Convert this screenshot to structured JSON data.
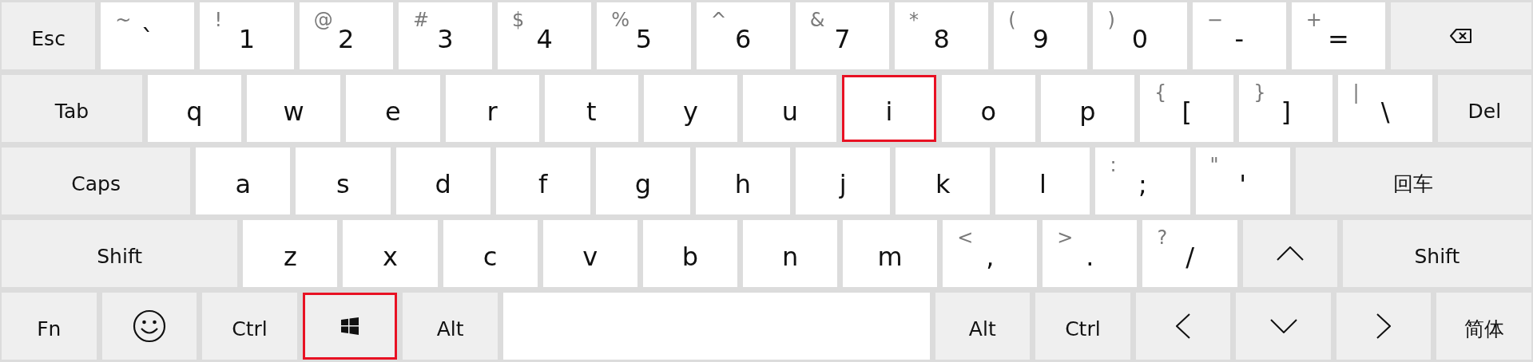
{
  "rows": [
    [
      {
        "kind": "func",
        "label": "Esc",
        "highlighted": false
      },
      {
        "kind": "char",
        "shift": "~",
        "label": "`",
        "highlighted": false
      },
      {
        "kind": "char",
        "shift": "!",
        "label": "1",
        "highlighted": false
      },
      {
        "kind": "char",
        "shift": "@",
        "label": "2",
        "highlighted": false
      },
      {
        "kind": "char",
        "shift": "#",
        "label": "3",
        "highlighted": false
      },
      {
        "kind": "char",
        "shift": "$",
        "label": "4",
        "highlighted": false
      },
      {
        "kind": "char",
        "shift": "%",
        "label": "5",
        "highlighted": false
      },
      {
        "kind": "char",
        "shift": "^",
        "label": "6",
        "highlighted": false
      },
      {
        "kind": "char",
        "shift": "&",
        "label": "7",
        "highlighted": false
      },
      {
        "kind": "char",
        "shift": "*",
        "label": "8",
        "highlighted": false
      },
      {
        "kind": "char",
        "shift": "(",
        "label": "9",
        "highlighted": false
      },
      {
        "kind": "char",
        "shift": ")",
        "label": "0",
        "highlighted": false
      },
      {
        "kind": "char",
        "shift": "−",
        "label": "-",
        "highlighted": false
      },
      {
        "kind": "char",
        "shift": "+",
        "label": "=",
        "highlighted": false
      },
      {
        "kind": "backspace",
        "highlighted": false
      }
    ],
    [
      {
        "kind": "func",
        "label": "Tab",
        "highlighted": false
      },
      {
        "kind": "char",
        "label": "q",
        "highlighted": false
      },
      {
        "kind": "char",
        "label": "w",
        "highlighted": false
      },
      {
        "kind": "char",
        "label": "e",
        "highlighted": false
      },
      {
        "kind": "char",
        "label": "r",
        "highlighted": false
      },
      {
        "kind": "char",
        "label": "t",
        "highlighted": false
      },
      {
        "kind": "char",
        "label": "y",
        "highlighted": false
      },
      {
        "kind": "char",
        "label": "u",
        "highlighted": false
      },
      {
        "kind": "char",
        "label": "i",
        "highlighted": true
      },
      {
        "kind": "char",
        "label": "o",
        "highlighted": false
      },
      {
        "kind": "char",
        "label": "p",
        "highlighted": false
      },
      {
        "kind": "char",
        "shift": "{",
        "label": "[",
        "highlighted": false
      },
      {
        "kind": "char",
        "shift": "}",
        "label": "]",
        "highlighted": false
      },
      {
        "kind": "char",
        "shift": "|",
        "label": "\\",
        "highlighted": false
      },
      {
        "kind": "func",
        "label": "Del",
        "highlighted": false
      }
    ],
    [
      {
        "kind": "func",
        "label": "Caps",
        "highlighted": false
      },
      {
        "kind": "char",
        "label": "a",
        "highlighted": false
      },
      {
        "kind": "char",
        "label": "s",
        "highlighted": false
      },
      {
        "kind": "char",
        "label": "d",
        "highlighted": false
      },
      {
        "kind": "char",
        "label": "f",
        "highlighted": false
      },
      {
        "kind": "char",
        "label": "g",
        "highlighted": false
      },
      {
        "kind": "char",
        "label": "h",
        "highlighted": false
      },
      {
        "kind": "char",
        "label": "j",
        "highlighted": false
      },
      {
        "kind": "char",
        "label": "k",
        "highlighted": false
      },
      {
        "kind": "char",
        "label": "l",
        "highlighted": false
      },
      {
        "kind": "char",
        "shift": ":",
        "label": ";",
        "highlighted": false
      },
      {
        "kind": "char",
        "shift": "\"",
        "label": "'",
        "highlighted": false
      },
      {
        "kind": "func",
        "label": "回车",
        "highlighted": false
      }
    ],
    [
      {
        "kind": "func",
        "label": "Shift",
        "highlighted": false
      },
      {
        "kind": "char",
        "label": "z",
        "highlighted": false
      },
      {
        "kind": "char",
        "label": "x",
        "highlighted": false
      },
      {
        "kind": "char",
        "label": "c",
        "highlighted": false
      },
      {
        "kind": "char",
        "label": "v",
        "highlighted": false
      },
      {
        "kind": "char",
        "label": "b",
        "highlighted": false
      },
      {
        "kind": "char",
        "label": "n",
        "highlighted": false
      },
      {
        "kind": "char",
        "label": "m",
        "highlighted": false
      },
      {
        "kind": "char",
        "shift": "<",
        "label": ",",
        "highlighted": false
      },
      {
        "kind": "char",
        "shift": ">",
        "label": ".",
        "highlighted": false
      },
      {
        "kind": "char",
        "shift": "?",
        "label": "/",
        "highlighted": false
      },
      {
        "kind": "up",
        "highlighted": false
      },
      {
        "kind": "func",
        "label": "Shift",
        "highlighted": false
      }
    ],
    [
      {
        "kind": "func",
        "label": "Fn",
        "highlighted": false
      },
      {
        "kind": "emoji",
        "highlighted": false
      },
      {
        "kind": "func",
        "label": "Ctrl",
        "highlighted": false
      },
      {
        "kind": "windows",
        "highlighted": true
      },
      {
        "kind": "func",
        "label": "Alt",
        "highlighted": false
      },
      {
        "kind": "space",
        "highlighted": false
      },
      {
        "kind": "func",
        "label": "Alt",
        "highlighted": false
      },
      {
        "kind": "func",
        "label": "Ctrl",
        "highlighted": false
      },
      {
        "kind": "left",
        "highlighted": false
      },
      {
        "kind": "down",
        "highlighted": false
      },
      {
        "kind": "right",
        "highlighted": false
      },
      {
        "kind": "func",
        "label": "简体",
        "highlighted": false
      }
    ]
  ]
}
